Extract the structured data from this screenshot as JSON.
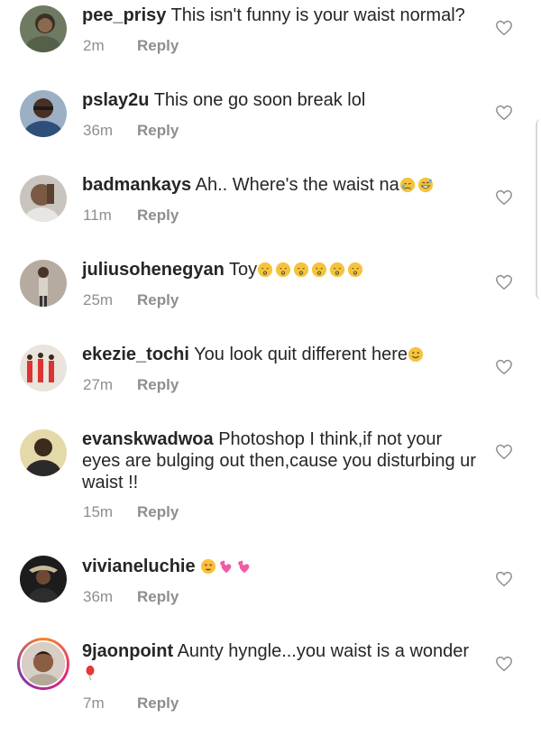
{
  "comments": [
    {
      "username": "pee_prisy",
      "text": "This isn't funny is your waist normal?",
      "time": "2m",
      "reply": "Reply",
      "emoji": []
    },
    {
      "username": "pslay2u",
      "text": "This one go soon break lol",
      "time": "36m",
      "reply": "Reply",
      "emoji": []
    },
    {
      "username": "badmankays",
      "text": "Ah.. Where's the waist na",
      "time": "11m",
      "reply": "Reply",
      "emoji": [
        "crying-face",
        "grinning-sweat-face"
      ]
    },
    {
      "username": "juliusohenegyan",
      "text": "Toy",
      "time": "25m",
      "reply": "Reply",
      "emoji": [
        "kissing-face",
        "kissing-face",
        "kissing-face",
        "kissing-face",
        "kissing-face",
        "kissing-face"
      ]
    },
    {
      "username": "ekezie_tochi",
      "text": "You look quit different here",
      "time": "27m",
      "reply": "Reply",
      "emoji": [
        "smiling-face"
      ]
    },
    {
      "username": "evanskwadwoa",
      "text": "Photoshop I think,if not your eyes are bulging out then,cause you disturbing ur waist !!",
      "time": "15m",
      "reply": "Reply",
      "emoji": []
    },
    {
      "username": "vivianeluchie",
      "text": "",
      "time": "36m",
      "reply": "Reply",
      "emoji": [
        "heart-eyes-face",
        "revolving-hearts",
        "revolving-hearts"
      ]
    },
    {
      "username": "9jaonpoint",
      "text": "Aunty hyngle...you waist is a wonder",
      "time": "7m",
      "reply": "Reply",
      "emoji": [
        "balloon"
      ]
    }
  ],
  "colors": {
    "text": "#262626",
    "meta": "#8e8e8e",
    "heart_outline": "#8e8e8e",
    "story_ring": "#dd2a7b"
  }
}
